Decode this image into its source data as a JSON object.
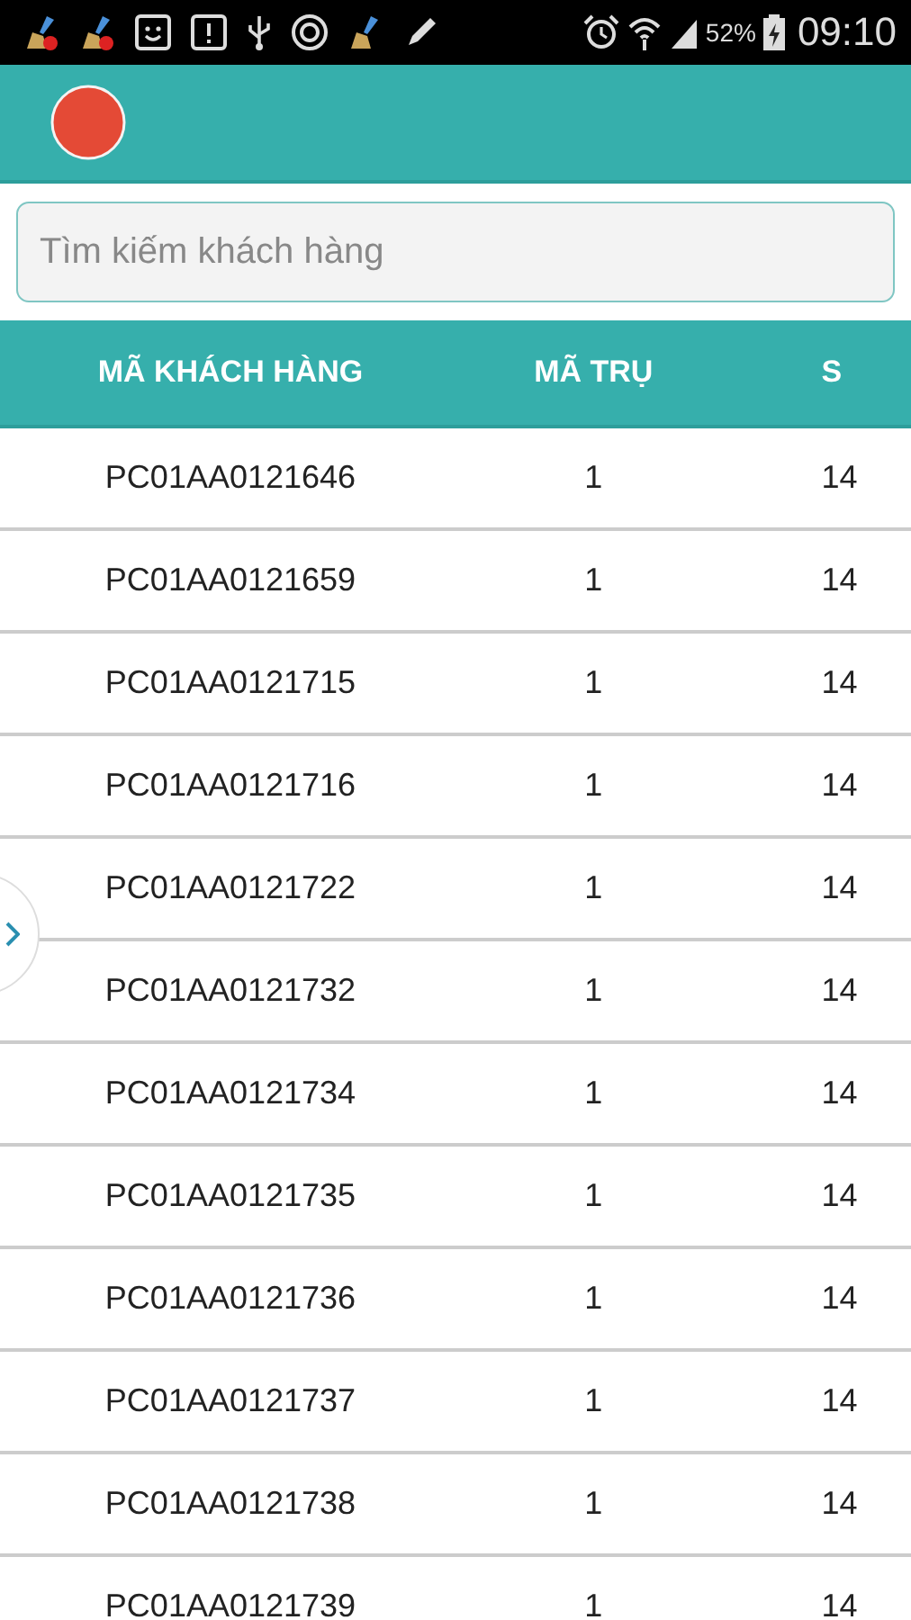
{
  "status_bar": {
    "battery": "52%",
    "time": "09:10"
  },
  "search": {
    "placeholder": "Tìm kiếm khách hàng"
  },
  "table": {
    "columns": [
      "MÃ KHÁCH HÀNG",
      "MÃ TRỤ",
      "S"
    ],
    "rows": [
      {
        "customer_code": "PC01AA0121646",
        "pole_code": "1",
        "column_3": "14"
      },
      {
        "customer_code": "PC01AA0121659",
        "pole_code": "1",
        "column_3": "14"
      },
      {
        "customer_code": "PC01AA0121715",
        "pole_code": "1",
        "column_3": "14"
      },
      {
        "customer_code": "PC01AA0121716",
        "pole_code": "1",
        "column_3": "14"
      },
      {
        "customer_code": "PC01AA0121722",
        "pole_code": "1",
        "column_3": "14"
      },
      {
        "customer_code": "PC01AA0121732",
        "pole_code": "1",
        "column_3": "14"
      },
      {
        "customer_code": "PC01AA0121734",
        "pole_code": "1",
        "column_3": "14"
      },
      {
        "customer_code": "PC01AA0121735",
        "pole_code": "1",
        "column_3": "14"
      },
      {
        "customer_code": "PC01AA0121736",
        "pole_code": "1",
        "column_3": "14"
      },
      {
        "customer_code": "PC01AA0121737",
        "pole_code": "1",
        "column_3": "14"
      },
      {
        "customer_code": "PC01AA0121738",
        "pole_code": "1",
        "column_3": "14"
      },
      {
        "customer_code": "PC01AA0121739",
        "pole_code": "1",
        "column_3": "14"
      }
    ]
  }
}
